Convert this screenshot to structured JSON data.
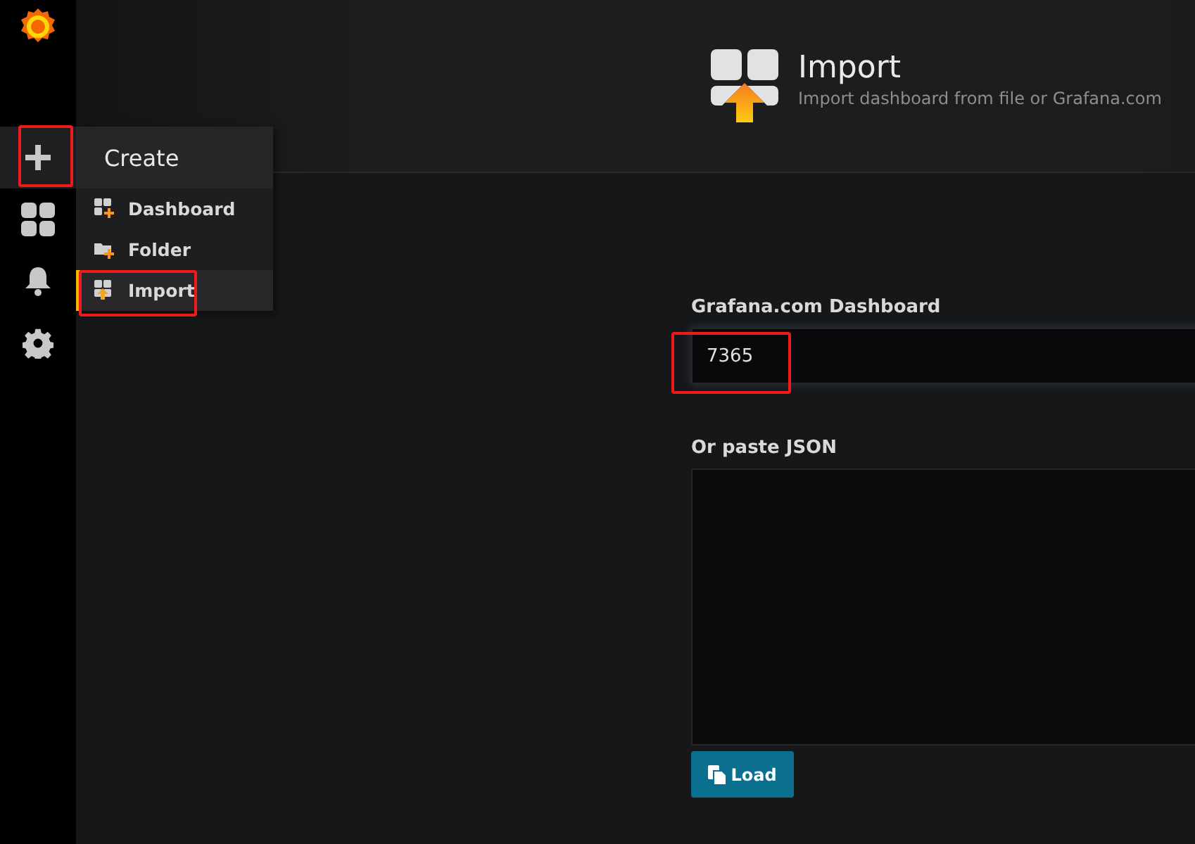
{
  "sidebar": {
    "items": [
      {
        "kind": "create",
        "selected": true
      },
      {
        "kind": "dashboards",
        "selected": false
      },
      {
        "kind": "alerts",
        "selected": false
      },
      {
        "kind": "settings",
        "selected": false
      }
    ]
  },
  "create_menu": {
    "title": "Create",
    "items": [
      {
        "kind": "dashboard",
        "label": "Dashboard",
        "selected": false
      },
      {
        "kind": "folder",
        "label": "Folder",
        "selected": false
      },
      {
        "kind": "import",
        "label": "Import",
        "selected": true
      }
    ]
  },
  "header": {
    "title": "Import",
    "subtitle": "Import dashboard from file or Grafana.com"
  },
  "form": {
    "dashboard_label": "Grafana.com Dashboard",
    "dashboard_value": "7365",
    "json_label": "Or paste JSON",
    "load_button": "Load"
  }
}
